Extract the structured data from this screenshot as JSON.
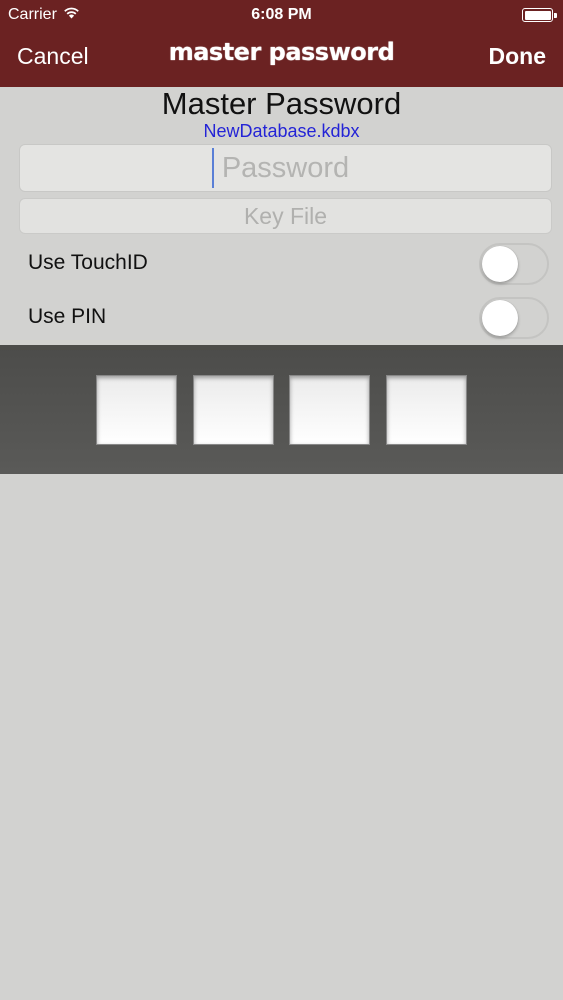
{
  "status_bar": {
    "carrier": "Carrier",
    "time": "6:08 PM",
    "wifi_icon": "wifi-icon",
    "battery_icon": "battery-icon"
  },
  "nav": {
    "cancel_label": "Cancel",
    "title": "master password",
    "done_label": "Done",
    "bar_color": "#6b2222"
  },
  "form": {
    "title": "Master Password",
    "database_name": "NewDatabase.kdbx",
    "database_name_color": "#2424d6",
    "password_placeholder": "Password",
    "password_value": "",
    "key_file_label": "Key File"
  },
  "toggles": [
    {
      "label": "Use TouchID",
      "on": false
    },
    {
      "label": "Use PIN",
      "on": false
    }
  ],
  "pin": {
    "digits": [
      "",
      "",
      "",
      ""
    ]
  }
}
